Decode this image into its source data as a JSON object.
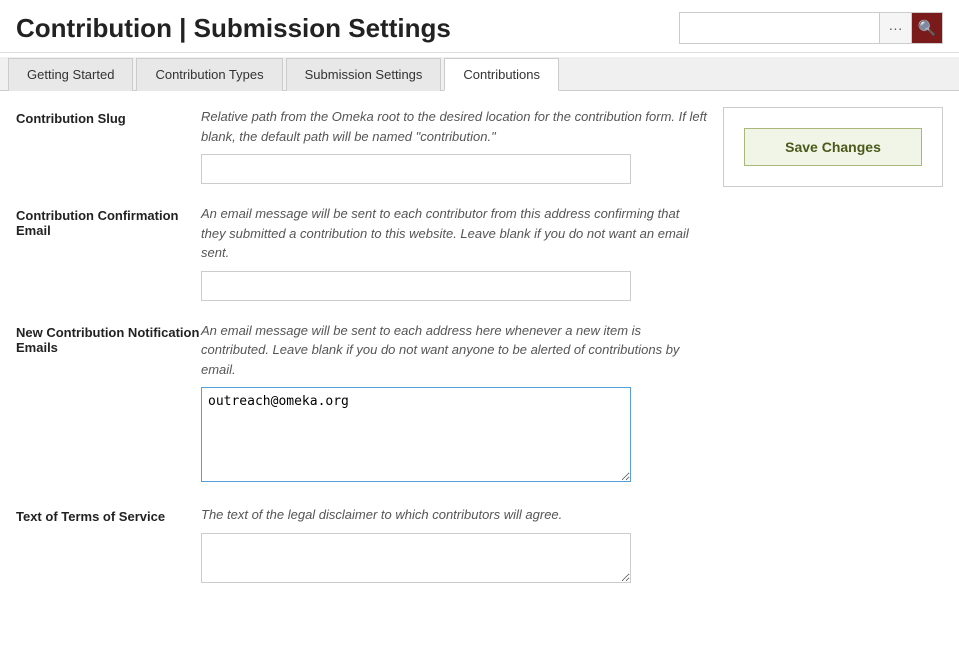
{
  "header": {
    "title": "Contribution | Submission Settings",
    "search_placeholder": "",
    "dots_icon": "···",
    "search_icon": "🔍"
  },
  "tabs": [
    {
      "id": "getting-started",
      "label": "Getting Started",
      "active": false
    },
    {
      "id": "contribution-types",
      "label": "Contribution Types",
      "active": false
    },
    {
      "id": "submission-settings",
      "label": "Submission Settings",
      "active": false
    },
    {
      "id": "contributions",
      "label": "Contributions",
      "active": true
    }
  ],
  "form": {
    "fields": [
      {
        "id": "contribution-slug",
        "label": "Contribution Slug",
        "description": "Relative path from the Omeka root to the desired location for the contribution form. If left blank, the default path will be named \"contribution.\"",
        "type": "input",
        "value": ""
      },
      {
        "id": "contribution-confirmation-email",
        "label": "Contribution Confirmation Email",
        "description": "An email message will be sent to each contributor from this address confirming that they submitted a contribution to this website. Leave blank if you do not want an email sent.",
        "type": "input",
        "value": ""
      },
      {
        "id": "new-contribution-notification-emails",
        "label": "New Contribution Notification Emails",
        "description": "An email message will be sent to each address here whenever a new item is contributed. Leave blank if you do not want anyone to be alerted of contributions by email.",
        "type": "textarea",
        "value": "outreach@omeka.org"
      },
      {
        "id": "text-of-terms-of-service",
        "label": "Text of Terms of Service",
        "description": "The text of the legal disclaimer to which contributors will agree.",
        "type": "textarea-terms",
        "value": ""
      }
    ]
  },
  "sidebar": {
    "save_button_label": "Save Changes"
  }
}
